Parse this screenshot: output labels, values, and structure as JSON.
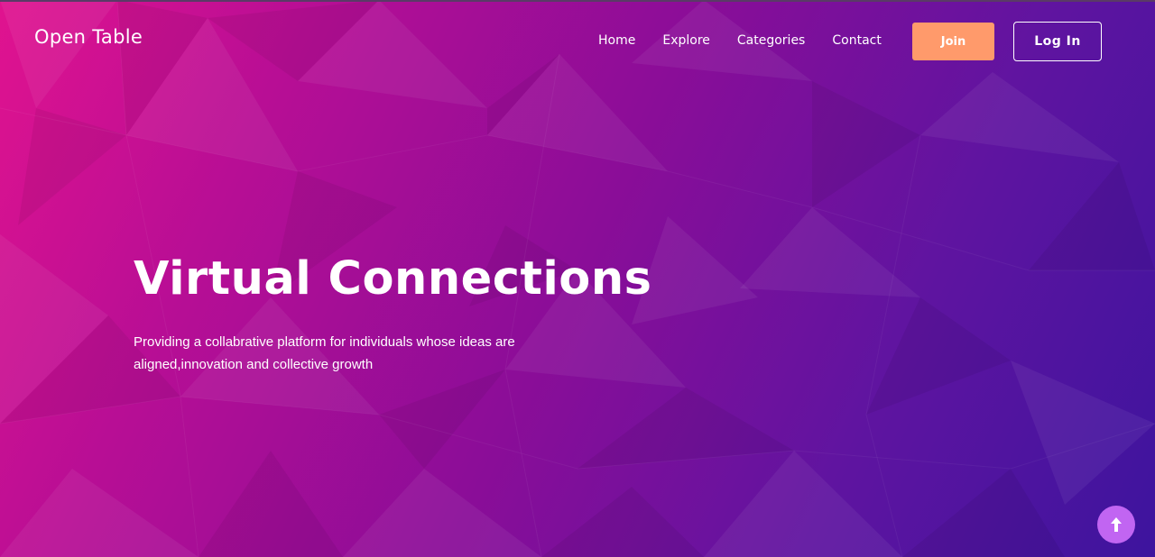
{
  "brand": {
    "name": "Open Table"
  },
  "nav": {
    "items": [
      {
        "label": "Home"
      },
      {
        "label": "Explore"
      },
      {
        "label": "Categories"
      },
      {
        "label": "Contact"
      }
    ]
  },
  "actions": {
    "join_label": "Join",
    "login_label": "Log In"
  },
  "hero": {
    "title": "Virtual Connections",
    "subtitle": "Providing a collabrative platform for individuals whose ideas are aligned,innovation and collective growth"
  },
  "colors": {
    "join_button": "#ff9a6b",
    "scroll_top_button": "#c165f2",
    "gradient_start": "#e0138f",
    "gradient_end": "#3d149e"
  },
  "icons": {
    "scroll_top": "arrow-up-icon"
  }
}
